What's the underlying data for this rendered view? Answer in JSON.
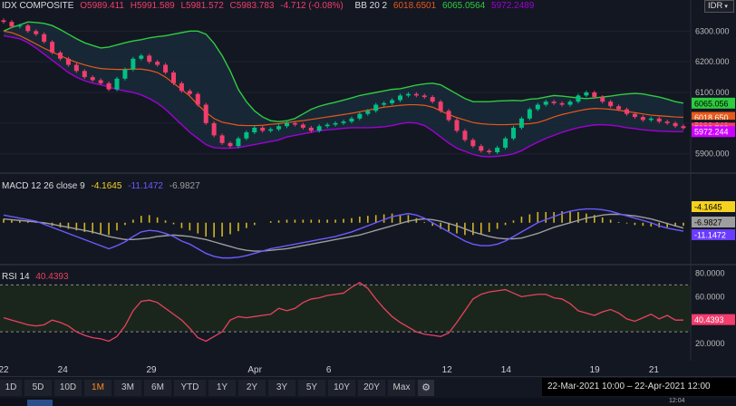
{
  "header": {
    "symbol": "IDX COMPOSITE",
    "open": "O5989.411",
    "high": "H5991.589",
    "low": "L5981.572",
    "close": "C5983.783",
    "change": "-4.712 (-0.08%)",
    "bb_label": "BB 20 2",
    "bb_mid": "6018.6501",
    "bb_upper": "6065.0564",
    "bb_lower": "5972.2489"
  },
  "symbol_selector": {
    "label": "IDR",
    "chevron": "▾"
  },
  "macd_legend": {
    "label": "MACD 12 26 close 9",
    "hist": "-4.1645",
    "macd": "-11.1472",
    "signal": "-6.9827"
  },
  "rsi_legend": {
    "label": "RSI 14",
    "value": "40.4393"
  },
  "price_axis": {
    "ticks": [
      "6300.000",
      "6200.000",
      "6100.000",
      "6000.000",
      "5900.000"
    ],
    "tags": [
      {
        "text": "6065.056",
        "bg": "#2ecc40",
        "fg": "#000000",
        "y": 6065.06
      },
      {
        "text": "6018.650",
        "bg": "#e8591a",
        "fg": "#ffffff",
        "y": 6018.65
      },
      {
        "text": "5993.242",
        "bg": "#131722",
        "fg": "#ffffff",
        "y": 5993.24
      },
      {
        "text": "5983.783",
        "bg": "#f23d6d",
        "fg": "#ffffff",
        "y": 5983.78
      },
      {
        "text": "5972.244",
        "bg": "#cc00ff",
        "fg": "#ffffff",
        "y": 5972.24
      }
    ]
  },
  "macd_axis": {
    "tags": [
      {
        "text": "-4.1645",
        "bg": "#f5d21f",
        "fg": "#000000",
        "y": -4.16
      },
      {
        "text": "-6.9827",
        "bg": "#9e9e9e",
        "fg": "#000000",
        "y": -6.98
      },
      {
        "text": "-11.1472",
        "bg": "#6a3cff",
        "fg": "#ffffff",
        "y": -11.15
      }
    ]
  },
  "rsi_axis": {
    "ticks": [
      "80.0000",
      "60.0000",
      "20.0000"
    ],
    "tag": {
      "text": "40.4393",
      "bg": "#f23d6d",
      "fg": "#ffffff",
      "y": 40.44
    }
  },
  "x_axis": {
    "labels": [
      {
        "text": "22",
        "t": 0
      },
      {
        "text": "24",
        "t": 2
      },
      {
        "text": "29",
        "t": 5
      },
      {
        "text": "Apr",
        "t": 8.5
      },
      {
        "text": "6",
        "t": 11
      },
      {
        "text": "12",
        "t": 15
      },
      {
        "text": "14",
        "t": 17
      },
      {
        "text": "19",
        "t": 20
      },
      {
        "text": "21",
        "t": 22
      }
    ]
  },
  "toolbar": {
    "buttons": [
      "1D",
      "5D",
      "10D",
      "1M",
      "3M",
      "6M",
      "YTD",
      "1Y",
      "2Y",
      "3Y",
      "5Y",
      "10Y",
      "20Y",
      "Max"
    ],
    "active": "1M",
    "gear": "⚙"
  },
  "date_range": "22-Mar-2021 10:00 – 22-Apr-2021 12:00",
  "clock": "12:04",
  "colors": {
    "bg": "#131722",
    "up": "#00c083",
    "down": "#f23d6d",
    "bb_upper": "#2ecc40",
    "bb_mid": "#e8591a",
    "bb_lower": "#a000d6",
    "macd_line": "#6a5cff",
    "signal_line": "#9e9e9e",
    "hist": "#f5d21f",
    "rsi": "#e8415f"
  },
  "chart_data": {
    "type": "line",
    "price": {
      "ylim": [
        5840,
        6360
      ],
      "close": [
        6330,
        6315,
        6318,
        6300,
        6290,
        6265,
        6230,
        6210,
        6190,
        6170,
        6150,
        6140,
        6130,
        6110,
        6145,
        6175,
        6210,
        6220,
        6200,
        6190,
        6165,
        6130,
        6105,
        6095,
        6060,
        6000,
        5960,
        5935,
        5925,
        5950,
        5970,
        5985,
        5975,
        5980,
        5990,
        6000,
        5995,
        5985,
        5975,
        5990,
        5995,
        6000,
        6005,
        6015,
        6030,
        6040,
        6060,
        6065,
        6075,
        6090,
        6095,
        6090,
        6085,
        6070,
        6040,
        6010,
        5975,
        5945,
        5925,
        5910,
        5905,
        5920,
        5950,
        5985,
        6015,
        6045,
        6060,
        6070,
        6065,
        6060,
        6070,
        6090,
        6100,
        6085,
        6070,
        6055,
        6045,
        6030,
        6020,
        6010,
        6015,
        6005,
        6000,
        5990,
        5984
      ],
      "bb_upper": [
        6300,
        6312,
        6320,
        6330,
        6328,
        6325,
        6318,
        6305,
        6290,
        6275,
        6262,
        6253,
        6245,
        6248,
        6255,
        6262,
        6268,
        6272,
        6278,
        6282,
        6285,
        6290,
        6295,
        6300,
        6300,
        6290,
        6260,
        6220,
        6170,
        6110,
        6070,
        6040,
        6020,
        6008,
        6005,
        6008,
        6015,
        6030,
        6045,
        6055,
        6062,
        6068,
        6075,
        6082,
        6090,
        6095,
        6100,
        6105,
        6110,
        6112,
        6118,
        6124,
        6128,
        6130,
        6125,
        6110,
        6095,
        6080,
        6070,
        6070,
        6070,
        6072,
        6073,
        6074,
        6073,
        6078,
        6080,
        6085,
        6090,
        6088,
        6085,
        6082,
        6080,
        6082,
        6085,
        6088,
        6092,
        6095,
        6097,
        6095,
        6090,
        6085,
        6078,
        6070,
        6065
      ],
      "bb_mid": [
        6300,
        6295,
        6285,
        6272,
        6258,
        6244,
        6232,
        6220,
        6208,
        6198,
        6190,
        6183,
        6178,
        6176,
        6175,
        6175,
        6176,
        6176,
        6172,
        6165,
        6150,
        6130,
        6110,
        6088,
        6060,
        6035,
        6015,
        6003,
        5998,
        5993,
        5992,
        5992,
        5993,
        5996,
        5998,
        6002,
        6005,
        6008,
        6012,
        6016,
        6020,
        6024,
        6028,
        6032,
        6037,
        6042,
        6047,
        6052,
        6055,
        6058,
        6060,
        6060,
        6058,
        6052,
        6040,
        6028,
        6018,
        6010,
        6002,
        5998,
        5996,
        5995,
        5995,
        5996,
        5997,
        5998,
        6002,
        6010,
        6020,
        6028,
        6034,
        6040,
        6045,
        6048,
        6047,
        6045,
        6042,
        6038,
        6034,
        6030,
        6026,
        6024,
        6022,
        6020,
        6019
      ],
      "bb_lower": [
        6285,
        6280,
        6275,
        6262,
        6245,
        6225,
        6205,
        6185,
        6165,
        6150,
        6138,
        6130,
        6125,
        6118,
        6110,
        6105,
        6100,
        6092,
        6080,
        6065,
        6045,
        6020,
        5995,
        5970,
        5950,
        5930,
        5920,
        5918,
        5918,
        5920,
        5925,
        5930,
        5935,
        5940,
        5945,
        5955,
        5960,
        5965,
        5970,
        5975,
        5978,
        5980,
        5983,
        5985,
        5985,
        5985,
        5986,
        5988,
        5992,
        5998,
        6002,
        6000,
        5992,
        5975,
        5955,
        5935,
        5918,
        5908,
        5898,
        5892,
        5890,
        5892,
        5895,
        5900,
        5910,
        5925,
        5938,
        5950,
        5960,
        5970,
        5978,
        5985,
        5990,
        5994,
        5995,
        5993,
        5990,
        5985,
        5982,
        5978,
        5976,
        5974,
        5973,
        5972,
        5972
      ]
    },
    "macd": {
      "ylim": [
        -50,
        40
      ],
      "macd": [
        10,
        8,
        6,
        4,
        2,
        -2,
        -6,
        -10,
        -14,
        -18,
        -22,
        -26,
        -30,
        -34,
        -30,
        -25,
        -18,
        -12,
        -10,
        -11,
        -14,
        -18,
        -24,
        -28,
        -34,
        -40,
        -44,
        -46,
        -46,
        -45,
        -43,
        -40,
        -37,
        -34,
        -32,
        -30,
        -28,
        -26,
        -24,
        -22,
        -20,
        -18,
        -15,
        -12,
        -8,
        -4,
        0,
        4,
        8,
        10,
        12,
        10,
        6,
        0,
        -6,
        -12,
        -18,
        -24,
        -28,
        -30,
        -30,
        -28,
        -24,
        -18,
        -12,
        -6,
        0,
        4,
        8,
        12,
        15,
        17,
        18,
        18,
        17,
        15,
        12,
        9,
        6,
        3,
        0,
        -4,
        -7,
        -9,
        -11
      ],
      "signal": [
        5,
        4,
        3,
        2,
        1,
        0,
        -2,
        -4,
        -6,
        -8,
        -10,
        -12,
        -15,
        -18,
        -20,
        -22,
        -22,
        -21,
        -20,
        -18,
        -17,
        -16,
        -17,
        -18,
        -20,
        -22,
        -25,
        -28,
        -31,
        -34,
        -36,
        -37,
        -37,
        -36,
        -35,
        -34,
        -32,
        -30,
        -28,
        -26,
        -24,
        -22,
        -20,
        -18,
        -16,
        -13,
        -10,
        -7,
        -4,
        -1,
        2,
        4,
        5,
        4,
        2,
        -1,
        -4,
        -8,
        -12,
        -15,
        -18,
        -20,
        -21,
        -21,
        -20,
        -17,
        -14,
        -10,
        -6,
        -3,
        0,
        3,
        6,
        8,
        10,
        11,
        11,
        10,
        9,
        7,
        5,
        2,
        -1,
        -4,
        -7
      ],
      "hist": [
        5,
        4,
        3,
        2,
        1,
        -2,
        -4,
        -6,
        -8,
        -10,
        -12,
        -14,
        -15,
        -16,
        -10,
        -3,
        4,
        9,
        10,
        7,
        3,
        -2,
        -7,
        -10,
        -14,
        -18,
        -19,
        -18,
        -15,
        -11,
        -7,
        -3,
        0,
        2,
        3,
        4,
        4,
        4,
        4,
        4,
        4,
        4,
        5,
        6,
        8,
        9,
        10,
        11,
        12,
        11,
        10,
        6,
        1,
        -4,
        -8,
        -11,
        -14,
        -16,
        -16,
        -15,
        -12,
        -8,
        -3,
        3,
        8,
        11,
        14,
        14,
        14,
        15,
        15,
        14,
        12,
        10,
        7,
        4,
        1,
        -1,
        -3,
        -4,
        -5,
        -6,
        -6,
        -5,
        -4
      ]
    },
    "rsi": {
      "ylim": [
        10,
        85
      ],
      "levels": [
        30,
        70
      ],
      "values": [
        42,
        40,
        38,
        36,
        35,
        36,
        40,
        38,
        35,
        30,
        27,
        25,
        24,
        22,
        26,
        35,
        48,
        56,
        57,
        55,
        50,
        45,
        40,
        33,
        25,
        22,
        26,
        30,
        40,
        43,
        42,
        43,
        44,
        45,
        50,
        48,
        50,
        55,
        58,
        59,
        61,
        62,
        63,
        68,
        72,
        67,
        58,
        50,
        43,
        38,
        34,
        30,
        28,
        27,
        26,
        29,
        38,
        48,
        58,
        62,
        64,
        65,
        66,
        63,
        60,
        61,
        62,
        62,
        59,
        58,
        54,
        48,
        46,
        44,
        47,
        49,
        46,
        41,
        39,
        42,
        45,
        41,
        44,
        40,
        40
      ]
    }
  }
}
